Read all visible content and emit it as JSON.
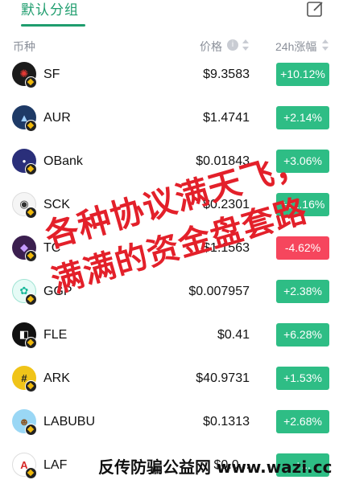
{
  "tabs": {
    "active_label": "默认分组"
  },
  "header": {
    "coin": "币种",
    "price": "价格",
    "info": "i",
    "change": "24h涨幅"
  },
  "rows": [
    {
      "symbol": "SF",
      "price": "$9.3583",
      "change": "+10.12%",
      "direction": "up"
    },
    {
      "symbol": "AUR",
      "price": "$1.4741",
      "change": "+2.14%",
      "direction": "up"
    },
    {
      "symbol": "OBank",
      "price": "$0.01843",
      "change": "+3.06%",
      "direction": "up"
    },
    {
      "symbol": "SCK",
      "price": "$0.2301",
      "change": "+11.16%",
      "direction": "up"
    },
    {
      "symbol": "TC",
      "price": "$1.1563",
      "change": "-4.62%",
      "direction": "down"
    },
    {
      "symbol": "GGP",
      "price": "$0.007957",
      "change": "+2.38%",
      "direction": "up"
    },
    {
      "symbol": "FLE",
      "price": "$0.41",
      "change": "+6.28%",
      "direction": "up"
    },
    {
      "symbol": "ARK",
      "price": "$40.9731",
      "change": "+1.53%",
      "direction": "up"
    },
    {
      "symbol": "LABUBU",
      "price": "$0.1313",
      "change": "+2.68%",
      "direction": "up"
    },
    {
      "symbol": "LAF",
      "price": "$0.0...",
      "change": "+...",
      "direction": "up"
    }
  ],
  "overlay": {
    "line1": "各种协议满天飞，",
    "line2": "满满的资金盘套路"
  },
  "watermark": "反传防骗公益网 www.wazi.cc",
  "colors": {
    "accent": "#1f9d6e",
    "up": "#2ebd85",
    "down": "#f6465d"
  }
}
